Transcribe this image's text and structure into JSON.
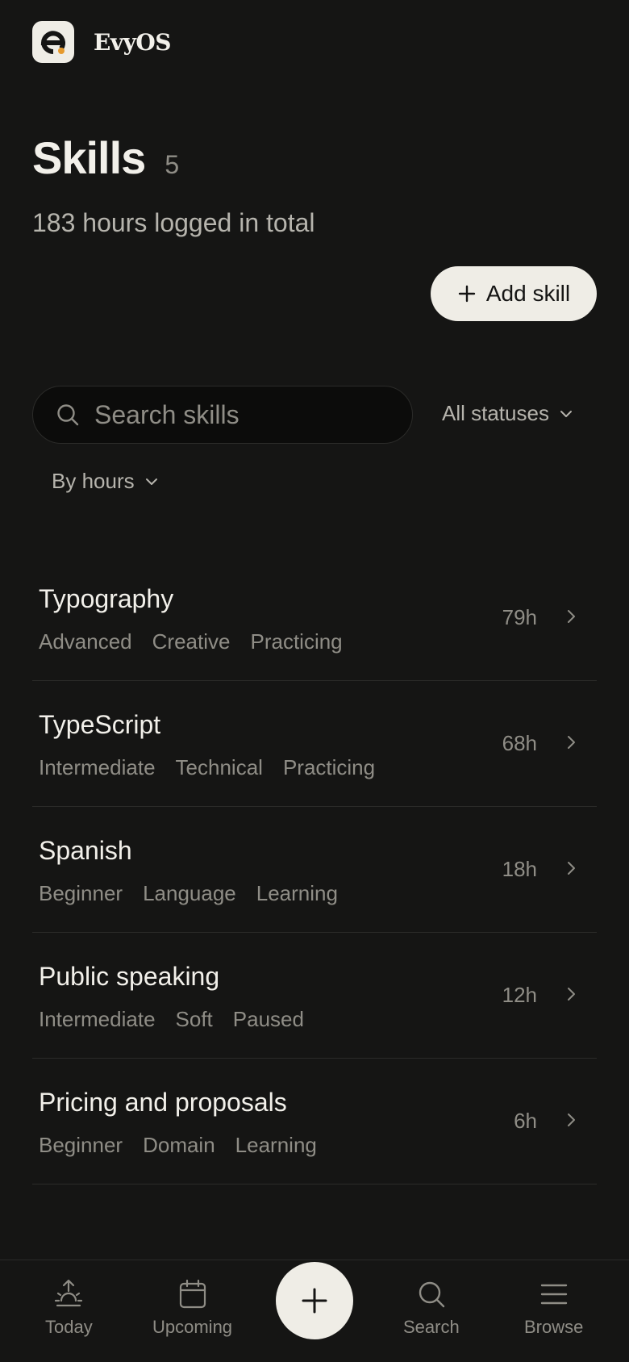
{
  "app": {
    "brand": "EvyOS"
  },
  "header": {
    "title": "Skills",
    "count": "5",
    "subtitle": "183 hours logged in total"
  },
  "actions": {
    "add_skill_label": "Add skill"
  },
  "filters": {
    "search_placeholder": "Search skills",
    "search_value": "",
    "status_selected": "All statuses",
    "sort_selected": "By hours"
  },
  "skills": [
    {
      "name": "Typography",
      "level": "Advanced",
      "category": "Creative",
      "status": "Practicing",
      "hours": "79h"
    },
    {
      "name": "TypeScript",
      "level": "Intermediate",
      "category": "Technical",
      "status": "Practicing",
      "hours": "68h"
    },
    {
      "name": "Spanish",
      "level": "Beginner",
      "category": "Language",
      "status": "Learning",
      "hours": "18h"
    },
    {
      "name": "Public speaking",
      "level": "Intermediate",
      "category": "Soft",
      "status": "Paused",
      "hours": "12h"
    },
    {
      "name": "Pricing and proposals",
      "level": "Beginner",
      "category": "Domain",
      "status": "Learning",
      "hours": "6h"
    }
  ],
  "nav": {
    "today": "Today",
    "upcoming": "Upcoming",
    "search": "Search",
    "browse": "Browse"
  },
  "colors": {
    "background": "#151514",
    "surface_light": "#efede6",
    "text_primary": "#f2f0ea",
    "text_muted": "#8f8d86",
    "logo_accent": "#e69a2e"
  }
}
